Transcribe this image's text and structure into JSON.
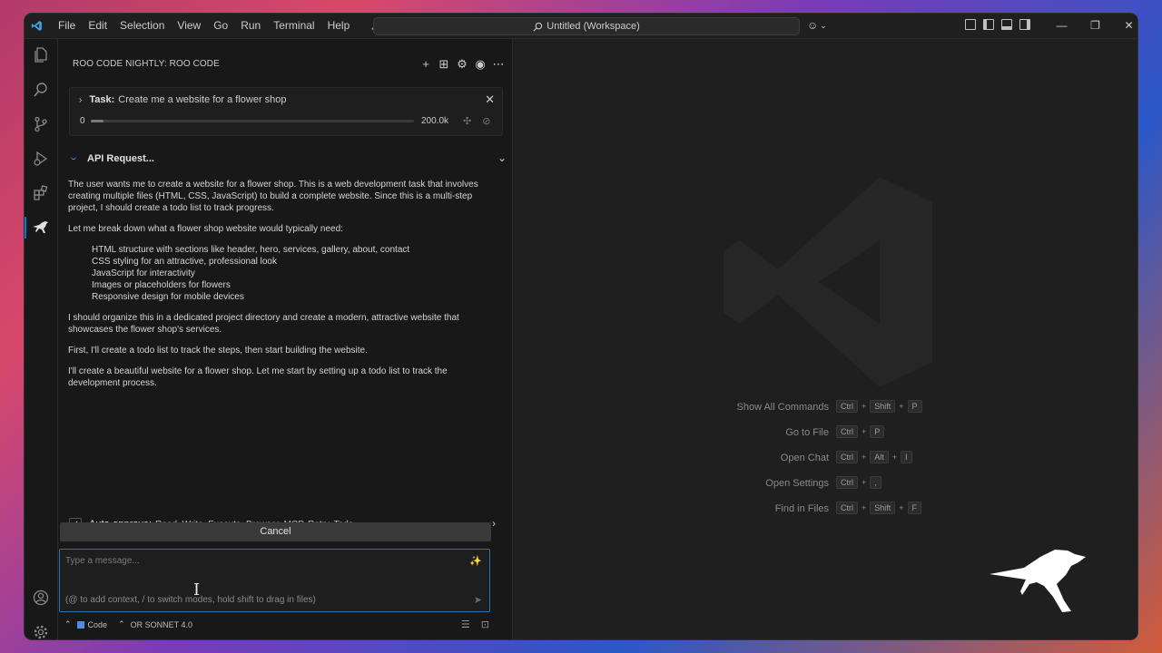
{
  "menu": [
    "File",
    "Edit",
    "Selection",
    "View",
    "Go",
    "Run",
    "Terminal",
    "Help"
  ],
  "command_center": "Untitled (Workspace)",
  "sidebar": {
    "header": "ROO CODE NIGHTLY: ROO CODE",
    "task": {
      "label": "Task:",
      "text": "Create me a website for a flower shop",
      "context_start": "0",
      "context_end": "200.0k",
      "context_fraction": 0.04
    },
    "api_request": "API Request...",
    "paragraphs": [
      "The user wants me to create a website for a flower shop. This is a web development task that involves creating multiple files (HTML, CSS, JavaScript) to build a complete website. Since this is a multi-step project, I should create a todo list to track progress.",
      "Let me break down what a flower shop website would typically need:"
    ],
    "needs": [
      "HTML structure with sections like header, hero, services, gallery, about, contact",
      "CSS styling for an attractive, professional look",
      "JavaScript for interactivity",
      "Images or placeholders for flowers",
      "Responsive design for mobile devices"
    ],
    "paragraphs_after": [
      "I should organize this in a dedicated project directory and create a modern, attractive website that showcases the flower shop's services.",
      "First, I'll create a todo list to track the steps, then start building the website.",
      "I'll create a beautiful website for a flower shop. Let me start by setting up a todo list to track the development process."
    ],
    "auto_approve_label": "Auto-approve:",
    "auto_approve_list": "Read, Write, Execute, Browser, MCP, Retry, Todo",
    "cancel_label": "Cancel",
    "input_placeholder": "Type a message...",
    "input_hint": "(@ to add context, / to switch modes, hold shift to drag in files)",
    "mode_label": "Code",
    "model_label": "OR SONNET 4.0"
  },
  "shortcuts": [
    {
      "label": "Show All Commands",
      "keys": [
        "Ctrl",
        "Shift",
        "P"
      ]
    },
    {
      "label": "Go to File",
      "keys": [
        "Ctrl",
        "P"
      ]
    },
    {
      "label": "Open Chat",
      "keys": [
        "Ctrl",
        "Alt",
        "I"
      ]
    },
    {
      "label": "Open Settings",
      "keys": [
        "Ctrl",
        ","
      ]
    },
    {
      "label": "Find in Files",
      "keys": [
        "Ctrl",
        "Shift",
        "F"
      ]
    }
  ],
  "colors": {
    "accent": "#0078d4",
    "input_border": "#2b6fb8"
  }
}
